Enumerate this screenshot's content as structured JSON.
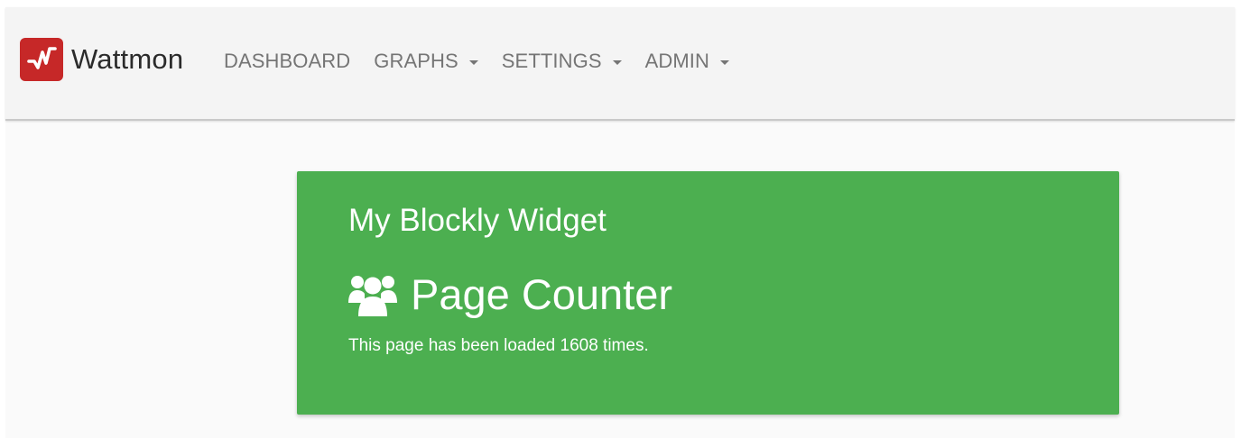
{
  "navbar": {
    "brand": {
      "name": "Wattmon",
      "logo_icon": "wattmon-logo-icon",
      "logo_color": "#c62828"
    },
    "items": [
      {
        "label": "DASHBOARD",
        "has_dropdown": false
      },
      {
        "label": "GRAPHS",
        "has_dropdown": true
      },
      {
        "label": "SETTINGS",
        "has_dropdown": true
      },
      {
        "label": "ADMIN",
        "has_dropdown": true
      }
    ],
    "background": "#f4f4f4"
  },
  "widget": {
    "title": "My Blockly Widget",
    "heading": "Page Counter",
    "heading_icon": "users-icon",
    "text": "This page has been loaded 1608 times.",
    "background": "#4caf50"
  }
}
